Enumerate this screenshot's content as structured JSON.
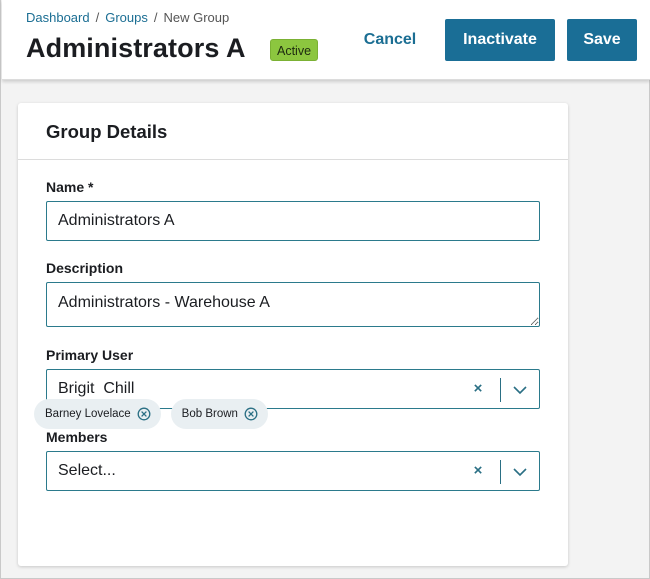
{
  "breadcrumb": {
    "items": [
      {
        "label": "Dashboard"
      },
      {
        "label": "Groups"
      },
      {
        "label": "New Group"
      }
    ],
    "separator": "/"
  },
  "header": {
    "title": "Administrators A",
    "status": "Active",
    "status_color": "#8cc63f",
    "cancel_label": "Cancel",
    "inactivate_label": "Inactivate",
    "save_label": "Save",
    "primary_color": "#1a6e96"
  },
  "card": {
    "title": "Group Details",
    "name_label": "Name *",
    "name_value": "Administrators A",
    "description_label": "Description",
    "description_value": "Administrators - Warehouse A",
    "primary_user_label": "Primary User",
    "primary_user_value": "Brigit  Chill",
    "members_label": "Members",
    "members_placeholder": "Select...",
    "members": [
      "Barney Lovelace",
      "Bob Brown"
    ]
  },
  "icons": {
    "clear": "×",
    "dropdown": "chevron-down-icon",
    "tag_remove": "circle-x-icon"
  }
}
